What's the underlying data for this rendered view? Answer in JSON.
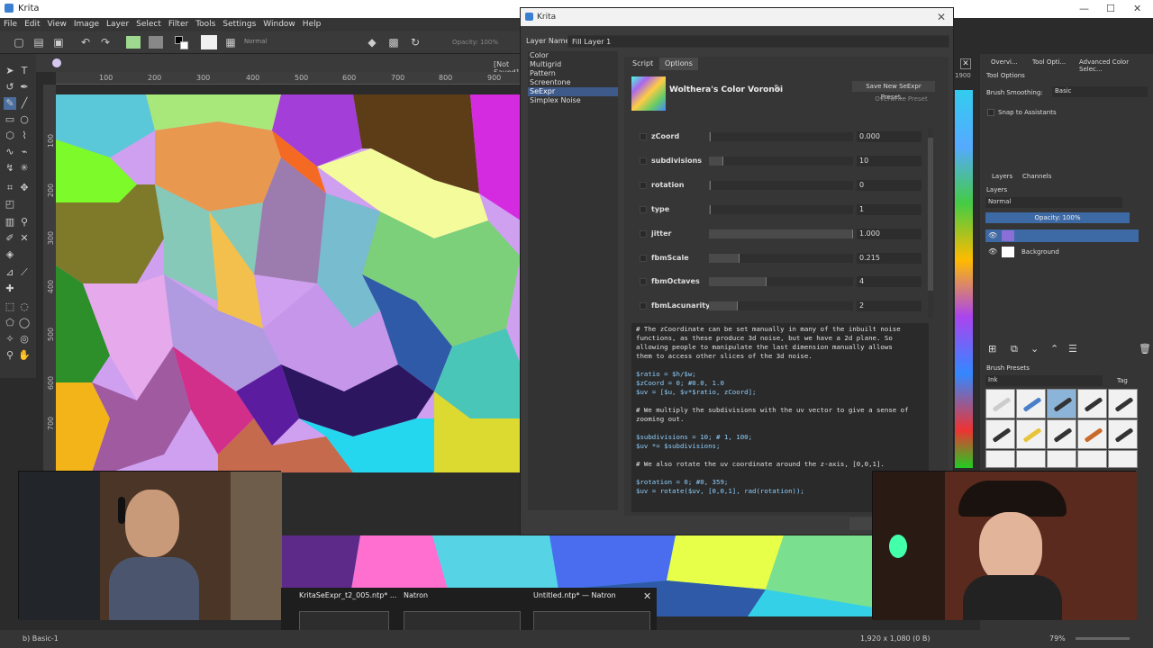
{
  "app": {
    "title": "Krita",
    "window_controls": [
      "—",
      "☐",
      "✕"
    ]
  },
  "menu": [
    "File",
    "Edit",
    "View",
    "Image",
    "Layer",
    "Select",
    "Filter",
    "Tools",
    "Settings",
    "Window",
    "Help"
  ],
  "toolbar": {
    "blend_mode": "Normal",
    "opacity": "Opacity: 100%",
    "not_saved": "[Not Saved]"
  },
  "ruler": {
    "top": [
      "100",
      "200",
      "300",
      "400",
      "500",
      "600",
      "700",
      "800",
      "900"
    ],
    "left": [
      "100",
      "200",
      "300",
      "400",
      "500",
      "600",
      "700"
    ],
    "right_edge": "1900"
  },
  "dialog": {
    "title": "Krita",
    "layer_name_label": "Layer Name:",
    "layer_name_value": "Fill Layer 1",
    "generators": [
      "Color",
      "Multigrid",
      "Pattern",
      "Screentone",
      "SeExpr",
      "Simplex Noise"
    ],
    "selected_generator": "SeExpr",
    "tabs": [
      "Script",
      "Options"
    ],
    "active_tab": "Options",
    "preset_name": "Wolthera's Color Voronoi",
    "save_preset": "Save New SeExpr Preset...",
    "overwrite_preset": "Overwrite Preset",
    "params": [
      {
        "name": "zCoord",
        "value": "0.000",
        "fill": 0.0
      },
      {
        "name": "subdivisions",
        "value": "10",
        "fill": 0.1
      },
      {
        "name": "rotation",
        "value": "0",
        "fill": 0.0
      },
      {
        "name": "type",
        "value": "1",
        "fill": 0.0
      },
      {
        "name": "jitter",
        "value": "1.000",
        "fill": 1.0
      },
      {
        "name": "fbmScale",
        "value": "0.215",
        "fill": 0.215
      },
      {
        "name": "fbmOctaves",
        "value": "4",
        "fill": 0.4
      },
      {
        "name": "fbmLacunarity",
        "value": "2",
        "fill": 0.2
      }
    ],
    "code_lines": [
      {
        "t": "c",
        "s": "# The zCoordinate can be set manually in many of the inbuilt noise"
      },
      {
        "t": "c",
        "s": "functions, as these produce 3d noise, but we have a 2d plane. So"
      },
      {
        "t": "c",
        "s": "allowing people to manipulate the last dimension manually allows"
      },
      {
        "t": "c",
        "s": "them to access other slices of the 3d noise."
      },
      {
        "t": "e",
        "s": ""
      },
      {
        "t": "k",
        "s": "$ratio = $h/$w;"
      },
      {
        "t": "k",
        "s": "$zCoord = 0; #0.0, 1.0"
      },
      {
        "t": "k",
        "s": "$uv = [$u, $v*$ratio, zCoord];"
      },
      {
        "t": "e",
        "s": ""
      },
      {
        "t": "c",
        "s": "# We multiply the subdivisions with the uv vector to give a sense of"
      },
      {
        "t": "c",
        "s": "zooming out."
      },
      {
        "t": "e",
        "s": ""
      },
      {
        "t": "k",
        "s": "$subdivisions = 10; # 1, 100;"
      },
      {
        "t": "k",
        "s": "$uv *= $subdivisions;"
      },
      {
        "t": "e",
        "s": ""
      },
      {
        "t": "c",
        "s": "# We also rotate the uv coordinate around the z-axis, [0,0,1]."
      },
      {
        "t": "e",
        "s": ""
      },
      {
        "t": "k",
        "s": "$rotation = 0; #0, 359;"
      },
      {
        "t": "k",
        "s": "$uv = rotate($uv, [0,0,1], rad(rotation));"
      }
    ]
  },
  "dock": {
    "tabs": [
      "Overvi...",
      "Tool Opti...",
      "Advanced Color Selec..."
    ],
    "tool_options_title": "Tool Options",
    "brush_smoothing_label": "Brush Smoothing:",
    "brush_smoothing_value": "Basic",
    "snap_label": "Snap to Assistants",
    "layer_tabs": [
      "Layers",
      "Channels"
    ],
    "layers_label": "Layers",
    "blend_mode": "Normal",
    "opacity": "Opacity: 100%",
    "layers": [
      "",
      "Background"
    ],
    "brush_presets_label": "Brush Presets",
    "brush_filter": "Ink",
    "tag_label": "Tag"
  },
  "taskbar": {
    "items": [
      "KritaSeExpr_t2_005.ntp* ...",
      "Natron",
      "Untitled.ntp* — Natron"
    ]
  },
  "status": {
    "brush": "b) Basic-1",
    "size": "1,920 x 1,080 (0 B)",
    "zoom": "79%"
  },
  "colors": {
    "accent": "#3d6aa5",
    "selection": "#3d5a8a"
  }
}
